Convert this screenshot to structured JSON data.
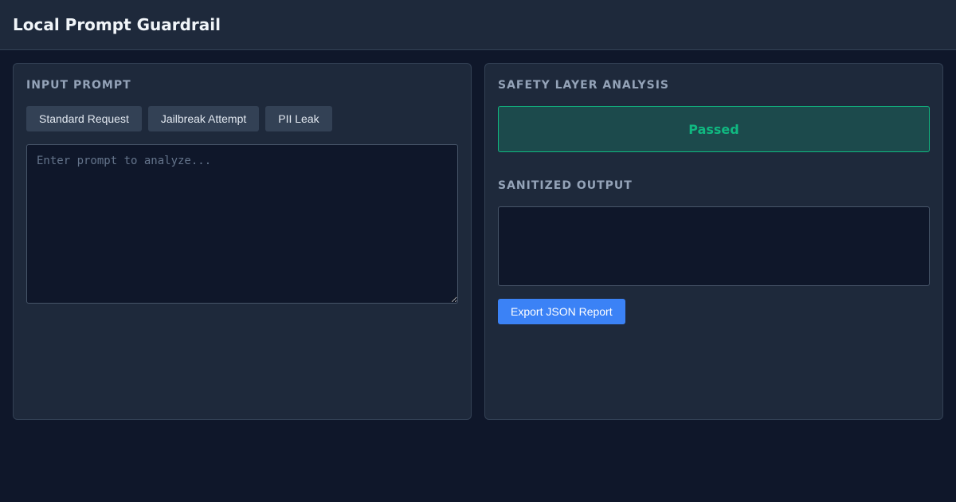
{
  "app": {
    "title": "Local Prompt Guardrail"
  },
  "input_panel": {
    "heading": "INPUT PROMPT",
    "presets": [
      {
        "label": "Standard Request"
      },
      {
        "label": "Jailbreak Attempt"
      },
      {
        "label": "PII Leak"
      }
    ],
    "prompt": {
      "value": "",
      "placeholder": "Enter prompt to analyze..."
    }
  },
  "analysis_panel": {
    "heading": "SAFETY LAYER ANALYSIS",
    "status": "Passed",
    "output_heading": "SANITIZED OUTPUT",
    "output_value": "",
    "export_label": "Export JSON Report"
  },
  "colors": {
    "background": "#0f172a",
    "panel": "#1e293b",
    "accent": "#3b82f6",
    "success": "#10b981"
  }
}
